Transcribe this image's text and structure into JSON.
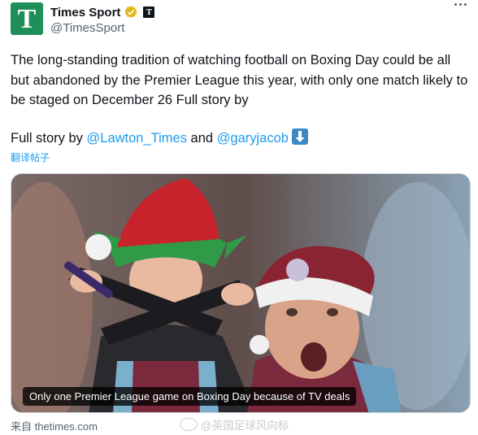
{
  "author": {
    "avatar_letter": "T",
    "display_name": "Times Sport",
    "handle": "@TimesSport",
    "verified": true,
    "affiliate_badge_letter": "T",
    "brand_color": "#1f8f5a"
  },
  "tweet": {
    "text": "The long-standing tradition of watching football on Boxing Day could be all but abandoned by the Premier League this year, with only one match likely to be staged on December 26  Full story by",
    "line2_prefix": "Full story by ",
    "mention1": "@Lawton_Times",
    "line2_and": " and ",
    "mention2": "@garyjacob",
    "emoji": "down-arrow-emoji",
    "translate_label": "翻译帖子"
  },
  "media": {
    "caption": "Only one Premier League game on Boxing Day because of TV deals"
  },
  "footer": {
    "source": "来自 thetimes.com",
    "watermark": "@英国足球风向标"
  },
  "colors": {
    "link": "#1d9bf0",
    "text": "#0f1419",
    "muted": "#536471"
  }
}
